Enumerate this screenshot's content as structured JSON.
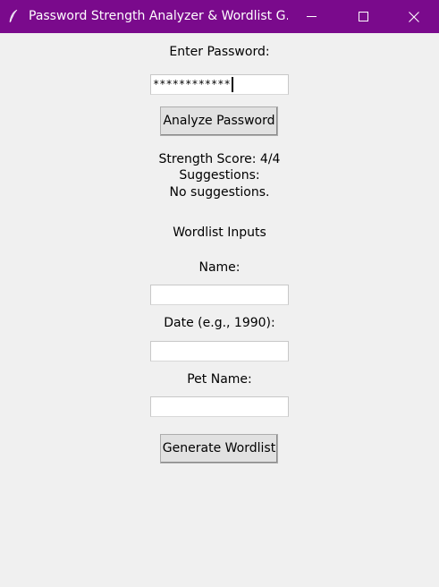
{
  "window": {
    "title": "Password Strength Analyzer & Wordlist G...",
    "titlebar_color": "#7a0a8c",
    "icon": "feather-icon",
    "controls": [
      "minimize-icon",
      "maximize-icon",
      "close-icon"
    ]
  },
  "password": {
    "label": "Enter Password:",
    "value": "************",
    "analyze_label": "Analyze Password"
  },
  "result": {
    "strength": "Strength Score: 4/4",
    "suggestions_label": "Suggestions:",
    "suggestions_text": "No suggestions."
  },
  "wordlist": {
    "heading": "Wordlist Inputs",
    "name_label": "Name:",
    "name_value": "",
    "date_label": "Date (e.g., 1990):",
    "date_value": "",
    "pet_label": "Pet Name:",
    "pet_value": "",
    "generate_label": "Generate Wordlist"
  }
}
